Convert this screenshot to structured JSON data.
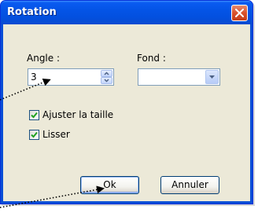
{
  "dialog": {
    "title": "Rotation",
    "close_icon": "close-icon"
  },
  "angle": {
    "label": "Angle :",
    "value": "3"
  },
  "fond": {
    "label": "Fond :",
    "value": ""
  },
  "options": {
    "resize_label": "Ajuster la taille",
    "resize_checked": true,
    "smooth_label": "Lisser",
    "smooth_checked": true
  },
  "buttons": {
    "ok_label": "Ok",
    "cancel_label": "Annuler"
  },
  "colors": {
    "titlebar": "#0a5bf0",
    "close_button": "#d9512c",
    "dialog_background": "#ece9d8",
    "checkmark": "#21a121"
  }
}
